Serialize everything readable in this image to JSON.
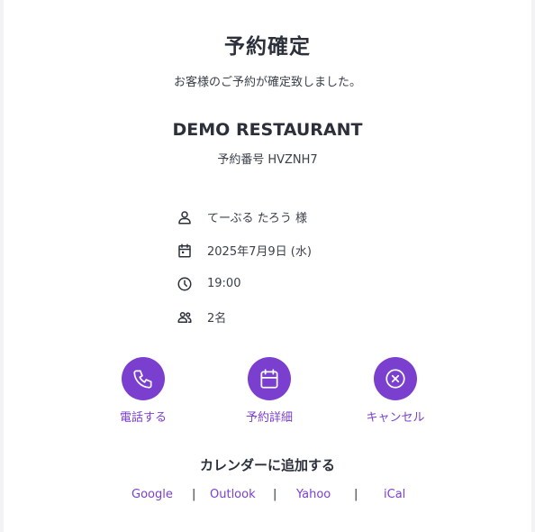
{
  "header": {
    "title": "予約確定",
    "subtitle": "お客様のご予約が確定致しました。"
  },
  "restaurant": {
    "name": "DEMO RESTAURANT",
    "booking_label": "予約番号",
    "booking_code": "HVZNH7"
  },
  "details": [
    {
      "icon": "person-icon",
      "text": "てーぶる たろう 様"
    },
    {
      "icon": "calendar-icon",
      "text": "2025年7月9日 (水)"
    },
    {
      "icon": "clock-icon",
      "text": "19:00"
    },
    {
      "icon": "people-icon",
      "text": "2名"
    }
  ],
  "actions": [
    {
      "icon": "phone-icon",
      "label": "電話する"
    },
    {
      "icon": "calendar-icon",
      "label": "予約詳細"
    },
    {
      "icon": "cancel-icon",
      "label": "キャンセル"
    }
  ],
  "calendar": {
    "title": "カレンダーに追加する",
    "links": [
      "Google",
      "Outlook",
      "Yahoo",
      "iCal"
    ],
    "separator": "|"
  },
  "colors": {
    "accent": "#7b3fd0",
    "text": "#2b303a"
  }
}
